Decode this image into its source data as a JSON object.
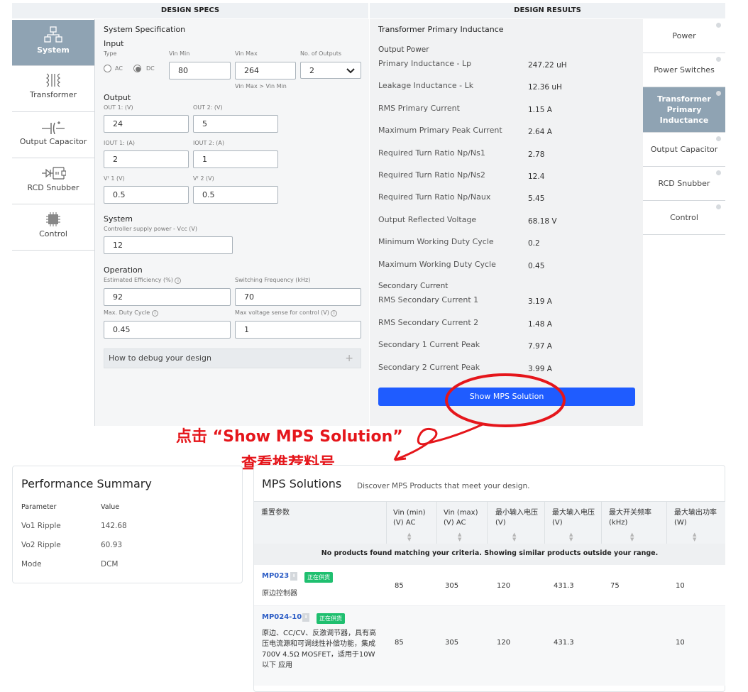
{
  "headers": {
    "specs": "DESIGN SPECS",
    "results": "DESIGN RESULTS"
  },
  "left_nav": [
    {
      "label": "System",
      "icon": "system-icon"
    },
    {
      "label": "Transformer",
      "icon": "transformer-icon"
    },
    {
      "label": "Output Capacitor",
      "icon": "capacitor-icon"
    },
    {
      "label": "RCD Snubber",
      "icon": "snubber-icon"
    },
    {
      "label": "Control",
      "icon": "chip-icon"
    }
  ],
  "spec": {
    "title": "System Specification",
    "input": {
      "title": "Input",
      "type_label": "Type",
      "ac_label": "AC",
      "dc_label": "DC",
      "selected": "DC",
      "vin_min_label": "Vin Min",
      "vin_min": "80",
      "vin_max_label": "Vin Max",
      "vin_max": "264",
      "vin_hint": "Vin Max > Vin Min",
      "outputs_label": "No. of Outputs",
      "outputs": "2"
    },
    "output": {
      "title": "Output",
      "out1_label": "OUT 1: (V)",
      "out1": "24",
      "out2_label": "OUT 2: (V)",
      "out2": "5",
      "iout1_label": "IOUT 1: (A)",
      "iout1": "2",
      "iout2_label": "IOUT 2: (A)",
      "iout2": "1",
      "vf1_label": "Vᶠ 1 (V)",
      "vf1": "0.5",
      "vf2_label": "Vᶠ 2 (V)",
      "vf2": "0.5"
    },
    "system": {
      "title": "System",
      "vcc_label": "Controller supply power - Vcc (V)",
      "vcc": "12"
    },
    "operation": {
      "title": "Operation",
      "eff_label": "Estimated Efficiency (%)",
      "eff": "92",
      "fsw_label": "Switching Frequency (kHz)",
      "fsw": "70",
      "duty_label": "Max. Duty Cycle",
      "duty": "0.45",
      "vsense_label": "Max voltage sense for control (V)",
      "vsense": "1"
    },
    "debug": "How to debug your design"
  },
  "results": {
    "title": "Transformer Primary Inductance",
    "output_power_title": "Output Power",
    "rows": [
      {
        "label": "Primary Inductance - Lp",
        "value": "247.22 uH"
      },
      {
        "label": "Leakage Inductance - Lk",
        "value": "12.36 uH"
      },
      {
        "label": "RMS Primary Current",
        "value": "1.15 A"
      },
      {
        "label": "Maximum Primary Peak Current",
        "value": "2.64 A"
      },
      {
        "label": "Required Turn Ratio Np/Ns1",
        "value": "2.78"
      },
      {
        "label": "Required Turn Ratio Np/Ns2",
        "value": "12.4"
      },
      {
        "label": "Required Turn Ratio Np/Naux",
        "value": "5.45"
      },
      {
        "label": "Output Reflected Voltage",
        "value": "68.18 V"
      },
      {
        "label": "Minimum Working Duty Cycle",
        "value": "0.2"
      },
      {
        "label": "Maximum Working Duty Cycle",
        "value": "0.45"
      }
    ],
    "secondary_title": "Secondary Current",
    "secondary_rows": [
      {
        "label": "RMS Secondary Current 1",
        "value": "3.19 A"
      },
      {
        "label": "RMS Secondary Current 2",
        "value": "1.48 A"
      },
      {
        "label": "Secondary 1 Current Peak",
        "value": "7.97 A"
      },
      {
        "label": "Secondary 2 Current Peak",
        "value": "3.99 A"
      }
    ],
    "button": "Show MPS Solution"
  },
  "right_nav": [
    "Power",
    "Power Switches",
    "Transformer Primary Inductance",
    "Output Capacitor",
    "RCD Snubber",
    "Control"
  ],
  "annotation": {
    "line1": "点击 “Show MPS Solution”",
    "line2": "查看推荐料号",
    "color": "#e5161b"
  },
  "performance": {
    "title": "Performance Summary",
    "col_param": "Parameter",
    "col_value": "Value",
    "rows": [
      {
        "param": "Vo1 Ripple",
        "value": "142.68"
      },
      {
        "param": "Vo2 Ripple",
        "value": "60.93"
      },
      {
        "param": "Mode",
        "value": "DCM"
      }
    ]
  },
  "solutions": {
    "title": "MPS Solutions",
    "subtitle": "Discover MPS Products that meet your design.",
    "columns": [
      "重置参数",
      "Vin (min) (V) AC",
      "Vin (max) (V) AC",
      "最小输入电压 (V)",
      "最大输入电压 (V)",
      "最大开关频率 (kHz)",
      "最大输出功率 (W)"
    ],
    "notice": "No products found matching your criteria. Showing similar products outside your range.",
    "rows": [
      {
        "part": "MP023",
        "status": "正在供货",
        "desc": "原边控制器",
        "vmin_ac": "85",
        "vmax_ac": "305",
        "vin_min": "120",
        "vin_max": "431.3",
        "fsw": "75",
        "pout": "10"
      },
      {
        "part": "MP024-10",
        "status": "正在供货",
        "desc": "原边、CC/CV、反激调节器，具有高压电流源和可调线性补偿功能，集成 700V 4.5Ω MOSFET，适用于10W以下 应用",
        "vmin_ac": "85",
        "vmax_ac": "305",
        "vin_min": "120",
        "vin_max": "431.3",
        "fsw": "",
        "pout": "10"
      }
    ]
  }
}
